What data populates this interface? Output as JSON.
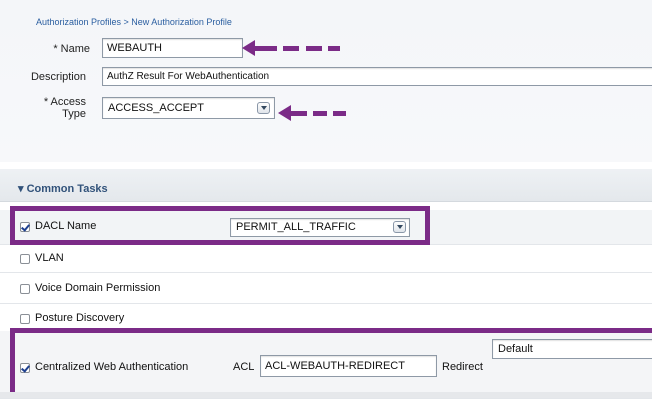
{
  "breadcrumb": "Authorization Profiles > New Authorization Profile",
  "form": {
    "name_label": "* Name",
    "name_value": "WEBAUTH",
    "description_label": "Description",
    "description_value": "AuthZ Result For WebAuthentication",
    "access_label_line1": "* Access",
    "access_label_line2": "Type",
    "access_value": "ACCESS_ACCEPT"
  },
  "common_tasks": {
    "header": "▾ Common Tasks",
    "dacl": {
      "label": "DACL Name",
      "checked": true,
      "value": "PERMIT_ALL_TRAFFIC"
    },
    "vlan": {
      "label": "VLAN",
      "checked": false
    },
    "voice": {
      "label": "Voice Domain Permission",
      "checked": false
    },
    "posture": {
      "label": "Posture Discovery",
      "checked": false
    },
    "cwa": {
      "label": "Centralized Web Authentication",
      "checked": true,
      "acl_label": "ACL",
      "acl_value": "ACL-WEBAUTH-REDIRECT",
      "redirect_label": "Redirect",
      "redirect_value": "Default"
    }
  },
  "colors": {
    "highlight": "#7b2b87",
    "link": "#2a5ea0",
    "section_header": "#31527a"
  },
  "icons": [
    "dropdown-arrow-icon",
    "checkbox-icon",
    "annotation-arrow-icon"
  ]
}
